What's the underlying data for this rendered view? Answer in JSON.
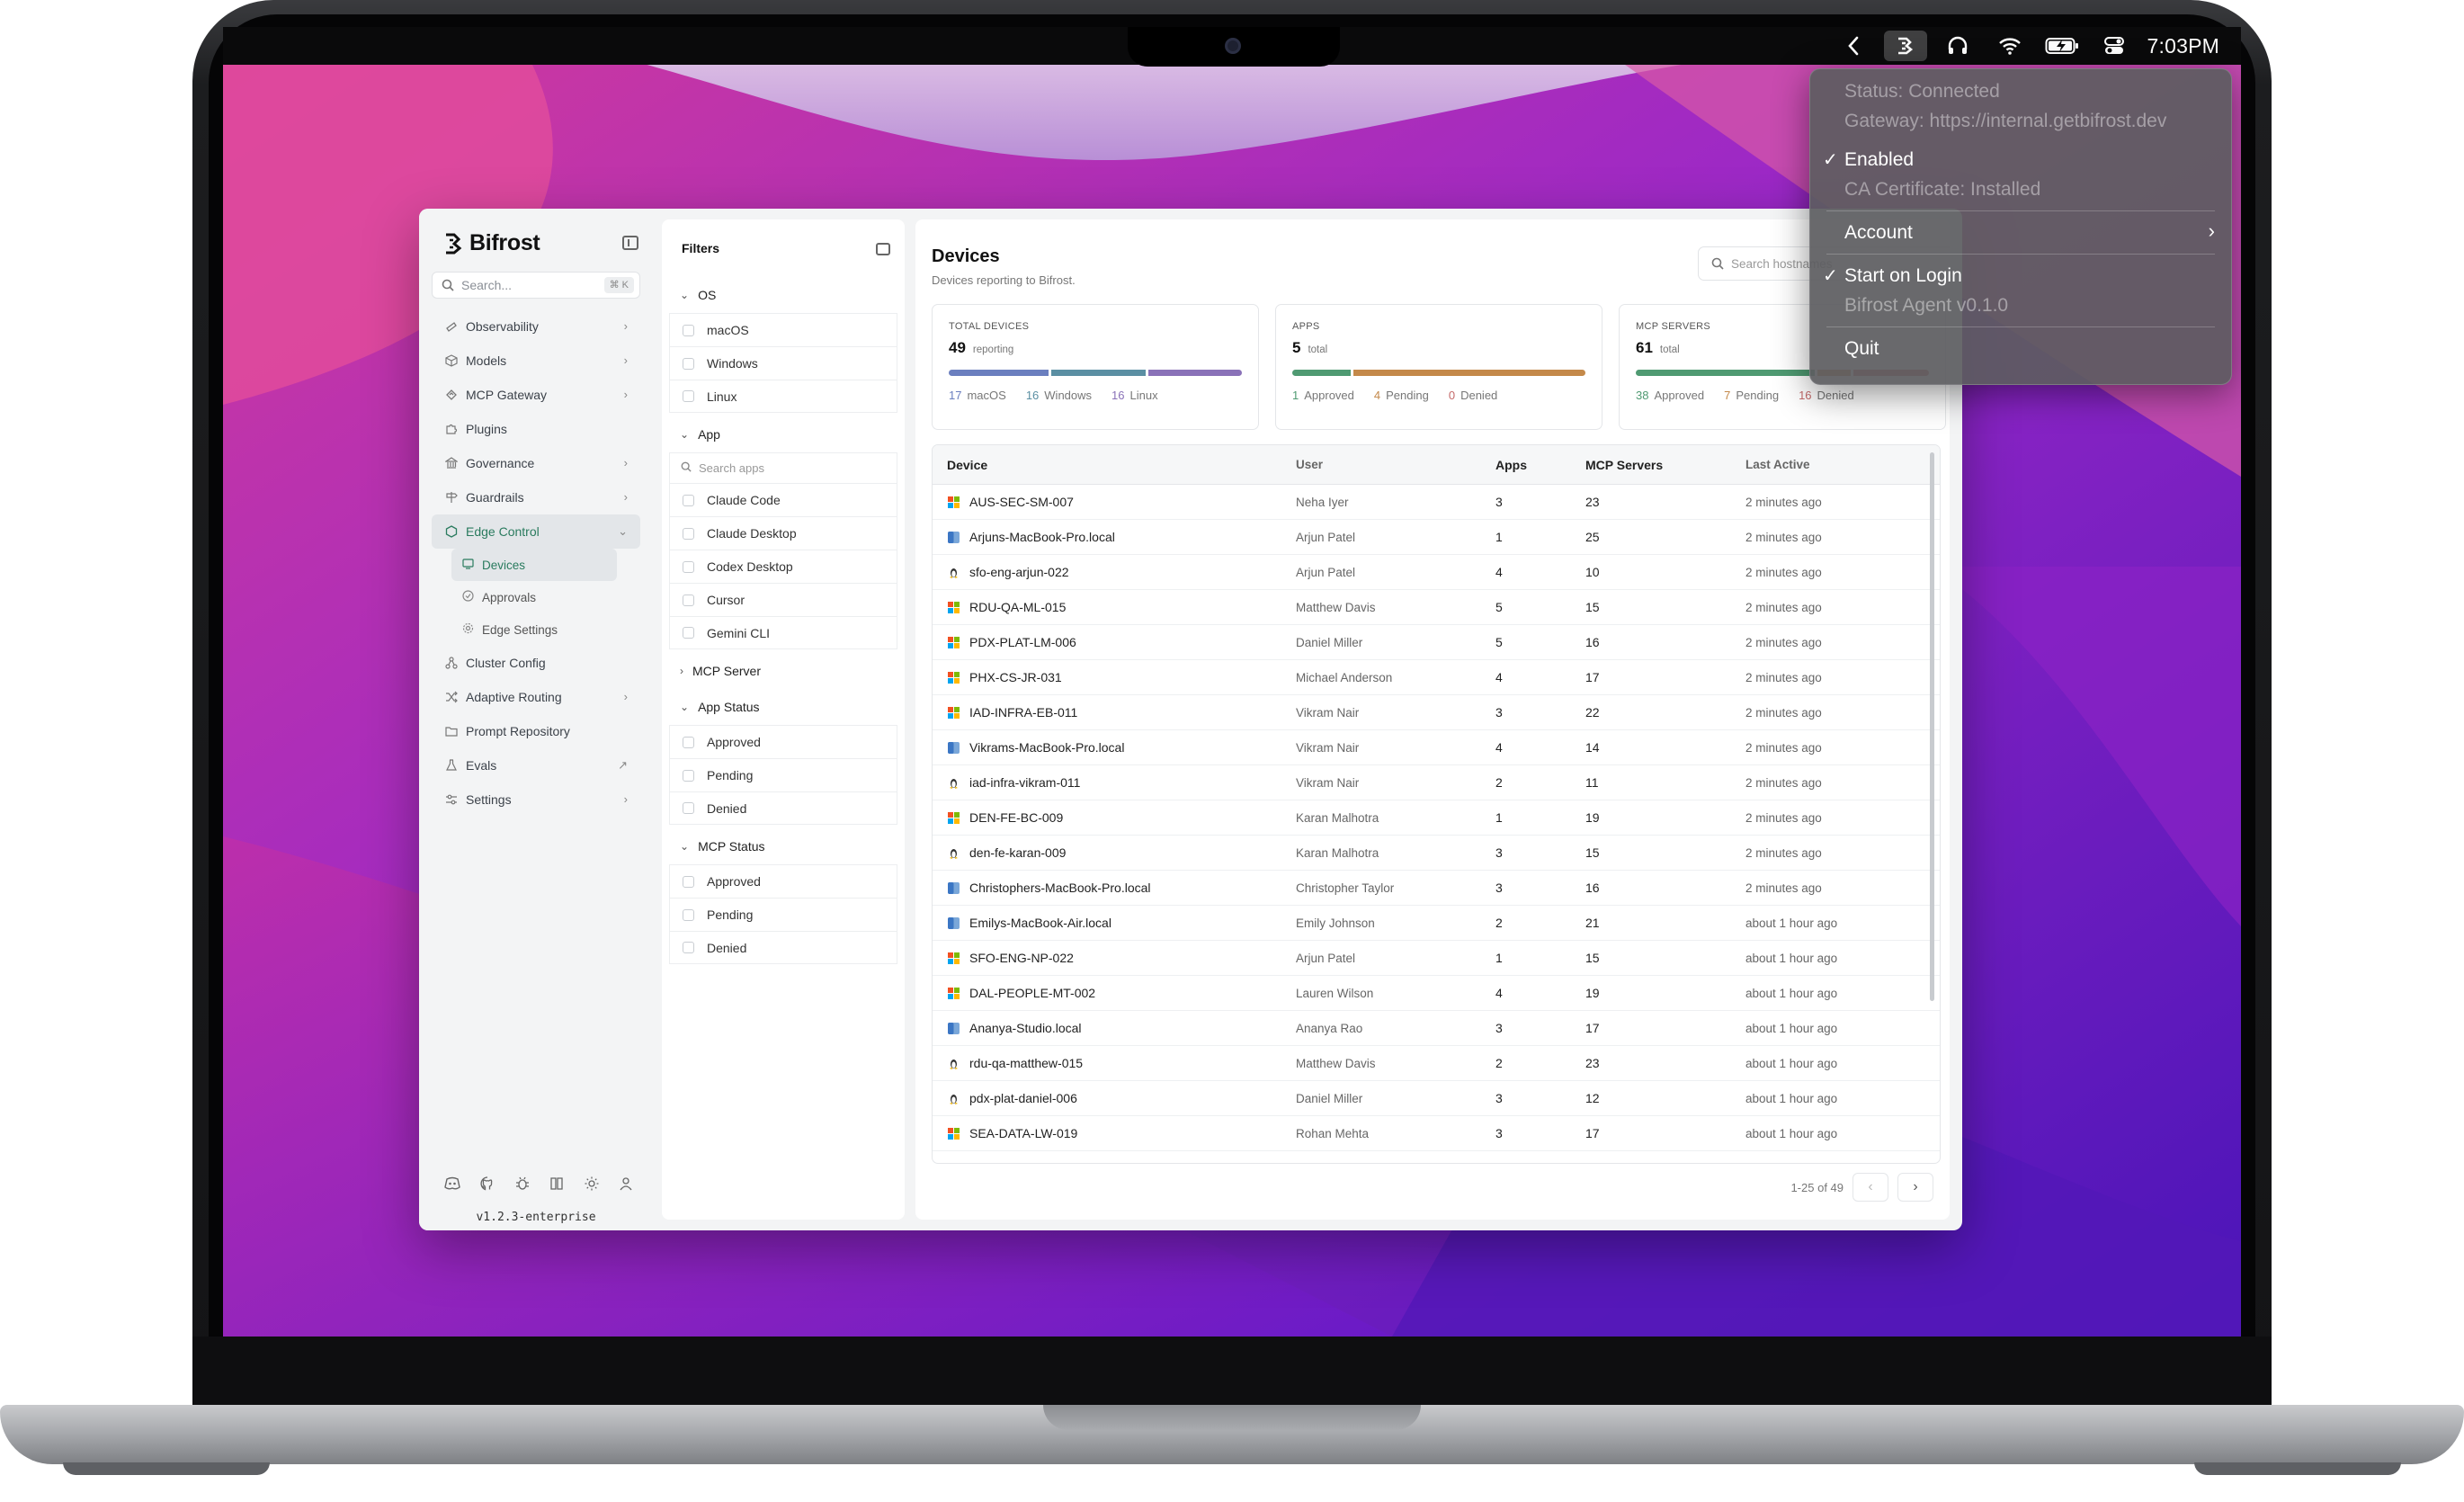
{
  "menubar": {
    "clock": "7:03PM",
    "icons": [
      "chevron-left-icon",
      "bifrost-agent-icon",
      "headphones-icon",
      "wifi-icon",
      "battery-charging-icon",
      "control-center-icon"
    ]
  },
  "dropdown": {
    "status": "Status: Connected",
    "gateway": "Gateway: https://internal.getbifrost.dev",
    "enabled": "Enabled",
    "ca_cert": "CA Certificate: Installed",
    "account": "Account",
    "start_on_login": "Start on Login",
    "agent_version": "Bifrost Agent v0.1.0",
    "quit": "Quit",
    "check": "✓",
    "chevron": "›"
  },
  "sidebar": {
    "brand": "Bifrost",
    "search_placeholder": "Search...",
    "search_shortcut": "⌘ K",
    "items": [
      {
        "label": "Observability",
        "icon": "telescope-icon",
        "chev": "›"
      },
      {
        "label": "Models",
        "icon": "box-icon",
        "chev": "›"
      },
      {
        "label": "MCP Gateway",
        "icon": "mcp-icon",
        "chev": "›"
      },
      {
        "label": "Plugins",
        "icon": "puzzle-icon",
        "chev": ""
      },
      {
        "label": "Governance",
        "icon": "bank-icon",
        "chev": "›"
      },
      {
        "label": "Guardrails",
        "icon": "signpost-icon",
        "chev": "›"
      },
      {
        "label": "Edge Control",
        "icon": "hexagon-icon",
        "chev": "⌄"
      }
    ],
    "sub_items": [
      {
        "label": "Devices",
        "icon": "devices-icon"
      },
      {
        "label": "Approvals",
        "icon": "check-circle-icon"
      },
      {
        "label": "Edge Settings",
        "icon": "gear-icon"
      }
    ],
    "items_after": [
      {
        "label": "Cluster Config",
        "icon": "network-icon",
        "chev": ""
      },
      {
        "label": "Adaptive Routing",
        "icon": "shuffle-icon",
        "chev": "›"
      },
      {
        "label": "Prompt Repository",
        "icon": "folder-icon",
        "chev": ""
      },
      {
        "label": "Evals",
        "icon": "flask-icon",
        "chev": "↗"
      },
      {
        "label": "Settings",
        "icon": "sliders-icon",
        "chev": "›"
      }
    ],
    "footer_icons": [
      "discord-icon",
      "github-icon",
      "bug-icon",
      "book-icon",
      "sun-icon",
      "user-icon"
    ],
    "version": "v1.2.3-enterprise"
  },
  "filters": {
    "title": "Filters",
    "groups": {
      "os": {
        "label": "OS",
        "options": [
          "macOS",
          "Windows",
          "Linux"
        ]
      },
      "app": {
        "label": "App",
        "search_placeholder": "Search apps",
        "options": [
          "Claude Code",
          "Claude Desktop",
          "Codex Desktop",
          "Cursor",
          "Gemini CLI"
        ]
      },
      "mcp_server": {
        "label": "MCP Server"
      },
      "app_status": {
        "label": "App Status",
        "options": [
          "Approved",
          "Pending",
          "Denied"
        ]
      },
      "mcp_status": {
        "label": "MCP Status",
        "options": [
          "Approved",
          "Pending",
          "Denied"
        ]
      }
    },
    "expanded": "⌄",
    "collapsed": "›"
  },
  "main": {
    "title": "Devices",
    "subtitle": "Devices reporting to Bifrost.",
    "search_placeholder": "Search hostnames",
    "cards": [
      {
        "label": "Total Devices",
        "value": "49",
        "unit": "reporting",
        "segments": [
          {
            "name": "macOS",
            "count": 17,
            "color": "#6b7fbf"
          },
          {
            "name": "Windows",
            "count": 16,
            "color": "#5b8fa3"
          },
          {
            "name": "Linux",
            "count": 16,
            "color": "#8a72b8"
          }
        ],
        "legend": [
          {
            "count": "17",
            "text": "macOS",
            "color": "#6b7fbf"
          },
          {
            "count": "16",
            "text": "Windows",
            "color": "#5b8fa3"
          },
          {
            "count": "16",
            "text": "Linux",
            "color": "#8a72b8"
          }
        ]
      },
      {
        "label": "Apps",
        "value": "5",
        "unit": "total",
        "segments": [
          {
            "name": "Approved",
            "count": 1,
            "color": "#4f9a72"
          },
          {
            "name": "Pending",
            "count": 4,
            "color": "#c4894a"
          },
          {
            "name": "Denied",
            "count": 0,
            "color": "#c56a6a"
          }
        ],
        "legend": [
          {
            "count": "1",
            "text": "Approved",
            "color": "#4f9a72"
          },
          {
            "count": "4",
            "text": "Pending",
            "color": "#c4894a"
          },
          {
            "count": "0",
            "text": "Denied",
            "color": "#c56a6a"
          }
        ]
      },
      {
        "label": "MCP Servers",
        "value": "61",
        "unit": "total",
        "segments": [
          {
            "name": "Approved",
            "count": 38,
            "color": "#4f9a72"
          },
          {
            "name": "Pending",
            "count": 7,
            "color": "#c4894a"
          },
          {
            "name": "Denied",
            "count": 16,
            "color": "#c56a6a"
          }
        ],
        "legend": [
          {
            "count": "38",
            "text": "Approved",
            "color": "#4f9a72"
          },
          {
            "count": "7",
            "text": "Pending",
            "color": "#c4894a"
          },
          {
            "count": "16",
            "text": "Denied",
            "color": "#c56a6a"
          }
        ]
      }
    ],
    "columns": [
      "Device",
      "User",
      "Apps",
      "MCP Servers",
      "Last Active"
    ],
    "rows": [
      {
        "device": "AUS-SEC-SM-007",
        "os": "windows",
        "user": "Neha Iyer",
        "apps": "3",
        "mcp": "23",
        "last": "2 minutes ago"
      },
      {
        "device": "Arjuns-MacBook-Pro.local",
        "os": "macos",
        "user": "Arjun Patel",
        "apps": "1",
        "mcp": "25",
        "last": "2 minutes ago"
      },
      {
        "device": "sfo-eng-arjun-022",
        "os": "linux",
        "user": "Arjun Patel",
        "apps": "4",
        "mcp": "10",
        "last": "2 minutes ago"
      },
      {
        "device": "RDU-QA-ML-015",
        "os": "windows",
        "user": "Matthew Davis",
        "apps": "5",
        "mcp": "15",
        "last": "2 minutes ago"
      },
      {
        "device": "PDX-PLAT-LM-006",
        "os": "windows",
        "user": "Daniel Miller",
        "apps": "5",
        "mcp": "16",
        "last": "2 minutes ago"
      },
      {
        "device": "PHX-CS-JR-031",
        "os": "windows",
        "user": "Michael Anderson",
        "apps": "4",
        "mcp": "17",
        "last": "2 minutes ago"
      },
      {
        "device": "IAD-INFRA-EB-011",
        "os": "windows",
        "user": "Vikram Nair",
        "apps": "3",
        "mcp": "22",
        "last": "2 minutes ago"
      },
      {
        "device": "Vikrams-MacBook-Pro.local",
        "os": "macos",
        "user": "Vikram Nair",
        "apps": "4",
        "mcp": "14",
        "last": "2 minutes ago"
      },
      {
        "device": "iad-infra-vikram-011",
        "os": "linux",
        "user": "Vikram Nair",
        "apps": "2",
        "mcp": "11",
        "last": "2 minutes ago"
      },
      {
        "device": "DEN-FE-BC-009",
        "os": "windows",
        "user": "Karan Malhotra",
        "apps": "1",
        "mcp": "19",
        "last": "2 minutes ago"
      },
      {
        "device": "den-fe-karan-009",
        "os": "linux",
        "user": "Karan Malhotra",
        "apps": "3",
        "mcp": "15",
        "last": "2 minutes ago"
      },
      {
        "device": "Christophers-MacBook-Pro.local",
        "os": "macos",
        "user": "Christopher Taylor",
        "apps": "3",
        "mcp": "16",
        "last": "2 minutes ago"
      },
      {
        "device": "Emilys-MacBook-Air.local",
        "os": "macos",
        "user": "Emily Johnson",
        "apps": "2",
        "mcp": "21",
        "last": "about 1 hour ago"
      },
      {
        "device": "SFO-ENG-NP-022",
        "os": "windows",
        "user": "Arjun Patel",
        "apps": "1",
        "mcp": "15",
        "last": "about 1 hour ago"
      },
      {
        "device": "DAL-PEOPLE-MT-002",
        "os": "windows",
        "user": "Lauren Wilson",
        "apps": "4",
        "mcp": "19",
        "last": "about 1 hour ago"
      },
      {
        "device": "Ananya-Studio.local",
        "os": "macos",
        "user": "Ananya Rao",
        "apps": "3",
        "mcp": "17",
        "last": "about 1 hour ago"
      },
      {
        "device": "rdu-qa-matthew-015",
        "os": "linux",
        "user": "Matthew Davis",
        "apps": "2",
        "mcp": "23",
        "last": "about 1 hour ago"
      },
      {
        "device": "pdx-plat-daniel-006",
        "os": "linux",
        "user": "Daniel Miller",
        "apps": "3",
        "mcp": "12",
        "last": "about 1 hour ago"
      },
      {
        "device": "SEA-DATA-LW-019",
        "os": "windows",
        "user": "Rohan Mehta",
        "apps": "3",
        "mcp": "17",
        "last": "about 1 hour ago"
      }
    ],
    "pagination": {
      "range": "1-25 of 49",
      "prev": "‹",
      "next": "›"
    }
  }
}
